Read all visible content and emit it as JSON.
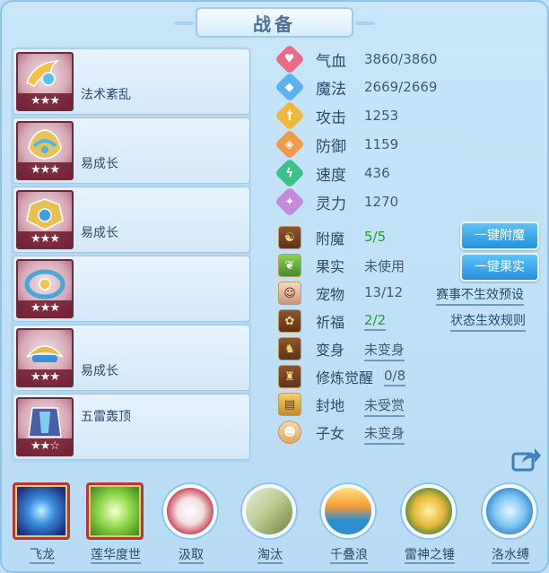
{
  "title": "战备",
  "equipment": [
    {
      "label": "法术紊乱",
      "stars": "★★★",
      "color": "#f3c04a"
    },
    {
      "label": "易成长",
      "stars": "★★★",
      "color": "#5fc1e8"
    },
    {
      "label": "易成长",
      "stars": "★★★",
      "color": "#e7c14f"
    },
    {
      "label": "",
      "stars": "★★★",
      "color": "#4aa7d8"
    },
    {
      "label": "易成长",
      "stars": "★★★",
      "color": "#e8b94a"
    },
    {
      "label": "五雷轰顶",
      "stars": "★★☆",
      "color": "#4a5fa8"
    }
  ],
  "stats": [
    {
      "name": "气血",
      "value": "3860/3860",
      "icon": "heart-icon",
      "color": "#ec6a86"
    },
    {
      "name": "魔法",
      "value": "2669/2669",
      "icon": "mana-icon",
      "color": "#5bb3f0"
    },
    {
      "name": "攻击",
      "value": "1253",
      "icon": "sword-icon",
      "color": "#f0b83a"
    },
    {
      "name": "防御",
      "value": "1159",
      "icon": "shield-icon",
      "color": "#f09a4a"
    },
    {
      "name": "速度",
      "value": "436",
      "icon": "lightning-icon",
      "color": "#3dc08a"
    },
    {
      "name": "灵力",
      "value": "1270",
      "icon": "spirit-icon",
      "color": "#c38ae0"
    }
  ],
  "misc": [
    {
      "name": "附魔",
      "value": "5/5",
      "icon": "enchant-icon"
    },
    {
      "name": "果实",
      "value": "未使用",
      "icon": "fruit-icon"
    },
    {
      "name": "宠物",
      "value": "13/12",
      "icon": "pet-icon"
    },
    {
      "name": "祈福",
      "value": "2/2",
      "icon": "blessing-icon"
    },
    {
      "name": "变身",
      "value": "未变身",
      "icon": "transform-icon"
    },
    {
      "name": "修炼觉醒",
      "value": "0/8",
      "icon": "cultivation-icon"
    },
    {
      "name": "封地",
      "value": "未受赏",
      "icon": "fief-icon"
    },
    {
      "name": "子女",
      "value": "未变身",
      "icon": "child-icon"
    }
  ],
  "buttons": {
    "enchant": "一键附魔",
    "fruit": "一键果实"
  },
  "links": {
    "event_preview": "赛事不生效预设",
    "status_rules": "状态生效规则"
  },
  "skills": [
    {
      "label": "飞龙",
      "style": "square"
    },
    {
      "label": "莲华度世",
      "style": "square"
    },
    {
      "label": "汲取",
      "style": "circle"
    },
    {
      "label": "淘汰",
      "style": "circle"
    },
    {
      "label": "千叠浪",
      "style": "circle"
    },
    {
      "label": "雷神之锤",
      "style": "circle"
    },
    {
      "label": "洛水缚",
      "style": "circle"
    }
  ]
}
